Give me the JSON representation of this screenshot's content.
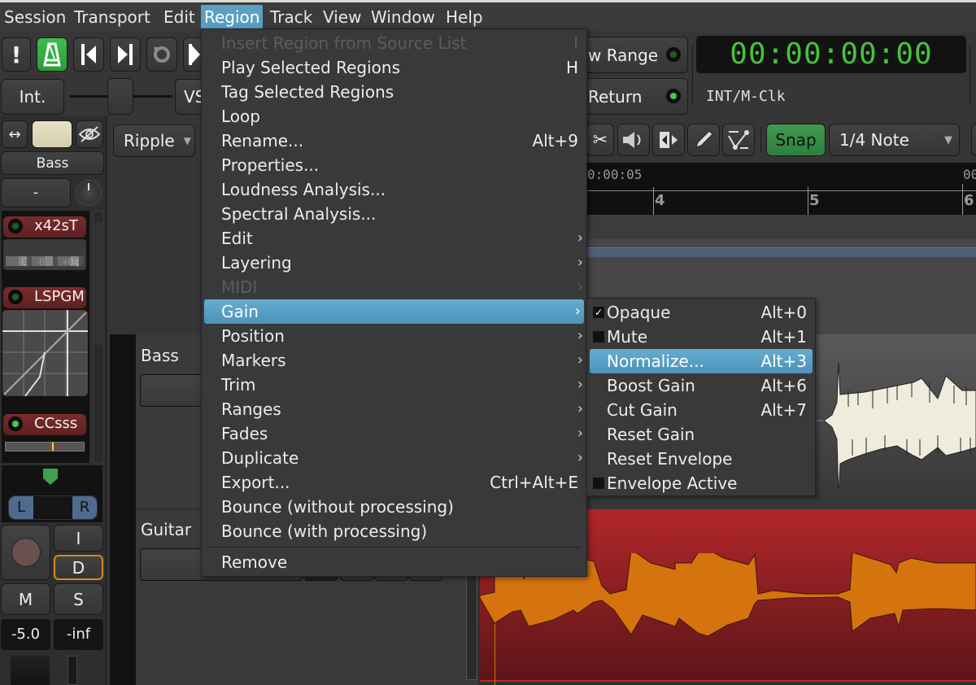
{
  "menubar": {
    "items": [
      "Session",
      "Transport",
      "Edit",
      "Region",
      "Track",
      "View",
      "Window",
      "Help"
    ],
    "active": "Region"
  },
  "transport": {
    "int_label": "Int.",
    "vs_label": "VS",
    "follow_range_label": "w Range",
    "auto_return_label": "Return",
    "clock": "00:00:00:00",
    "clock_source": "INT/M-Clk"
  },
  "edit_toolbar": {
    "edit_mode": "Ripple",
    "snap_label": "Snap",
    "grid_value": "1/4 Note"
  },
  "ruler": {
    "timecode": "0:00:05",
    "timecode_right": "00",
    "bars": [
      "4",
      "5",
      "6"
    ]
  },
  "mixer_strip": {
    "track_name": "Bass",
    "input_label": "-",
    "plugins": [
      {
        "name": "x42sT",
        "active": false,
        "readout": "C  0   +0¢"
      },
      {
        "name": "LSPGM",
        "active": false
      },
      {
        "name": "CCsss",
        "active": true
      }
    ],
    "pan_left": "L",
    "pan_right": "R",
    "input_button": "I",
    "disk_button": "D",
    "mute_button": "M",
    "solo_button": "S",
    "gain_value": "-5.0",
    "peak_value": "-inf"
  },
  "tracks": [
    {
      "name": "Bass"
    },
    {
      "name": "Guitar"
    }
  ],
  "region_menu": {
    "items": [
      {
        "label": "Insert Region from Source List",
        "accel": "I",
        "disabled": true
      },
      {
        "label": "Play Selected Regions",
        "accel": "H"
      },
      {
        "label": "Tag Selected Regions",
        "accel": ""
      },
      {
        "label": "Loop",
        "accel": ""
      },
      {
        "label": "Rename...",
        "accel": "Alt+9"
      },
      {
        "label": "Properties...",
        "accel": ""
      },
      {
        "label": "Loudness Analysis...",
        "accel": ""
      },
      {
        "label": "Spectral Analysis...",
        "accel": ""
      },
      {
        "label": "Edit",
        "submenu": true
      },
      {
        "label": "Layering",
        "submenu": true
      },
      {
        "label": "MIDI",
        "submenu": true,
        "disabled": true
      },
      {
        "label": "Gain",
        "submenu": true,
        "highlighted": true
      },
      {
        "label": "Position",
        "submenu": true
      },
      {
        "label": "Markers",
        "submenu": true
      },
      {
        "label": "Trim",
        "submenu": true
      },
      {
        "label": "Ranges",
        "submenu": true
      },
      {
        "label": "Fades",
        "submenu": true
      },
      {
        "label": "Duplicate",
        "submenu": true
      },
      {
        "label": "Export...",
        "accel": "Ctrl+Alt+E"
      },
      {
        "label": "Bounce (without processing)",
        "accel": ""
      },
      {
        "label": "Bounce (with processing)",
        "accel": ""
      },
      {
        "label": "Remove",
        "accel": ""
      }
    ]
  },
  "gain_submenu": {
    "items": [
      {
        "label": "Opaque",
        "accel": "Alt+0",
        "checkbox": true,
        "checked": true
      },
      {
        "label": "Mute",
        "accel": "Alt+1",
        "checkbox": true,
        "checked": false
      },
      {
        "label": "Normalize...",
        "accel": "Alt+3",
        "highlighted": true
      },
      {
        "label": "Boost Gain",
        "accel": "Alt+6"
      },
      {
        "label": "Cut Gain",
        "accel": "Alt+7"
      },
      {
        "label": "Reset Gain",
        "accel": ""
      },
      {
        "label": "Reset Envelope",
        "accel": ""
      },
      {
        "label": "Envelope Active",
        "accel": "",
        "checkbox": true,
        "checked": false
      }
    ]
  },
  "colors": {
    "menu_highlight": "#5b9fc4",
    "clock_green": "#46c33c",
    "snap_green": "#3f9a50",
    "guitar_region": "#a82427",
    "guitar_wave": "#d5730f",
    "bass_wave": "#f0ecdc"
  }
}
